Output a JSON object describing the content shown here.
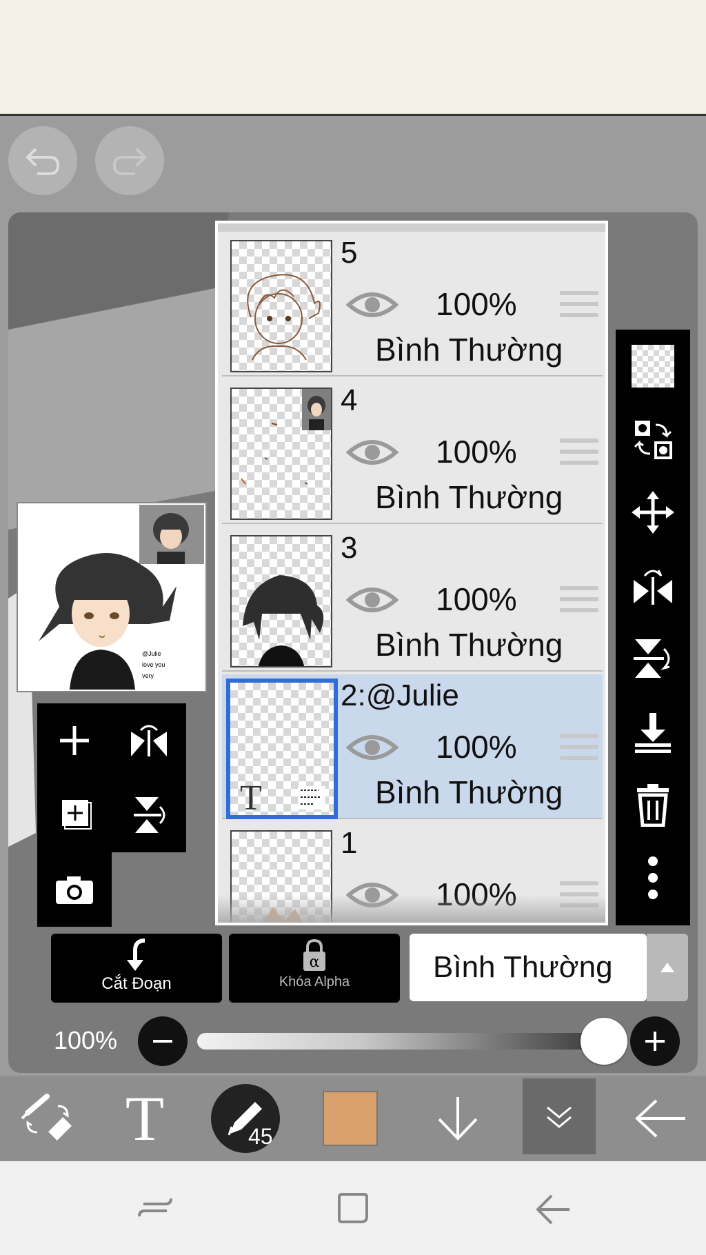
{
  "app": {
    "undo_icon": "undo-icon",
    "redo_icon": "redo-icon"
  },
  "preview": {
    "text": [
      "@Julie",
      "love you",
      "very"
    ]
  },
  "layers": [
    {
      "name": "5",
      "opacity": "100%",
      "blend": "Bình Thường",
      "visible": true,
      "selected": false
    },
    {
      "name": "4",
      "opacity": "100%",
      "blend": "Bình Thường",
      "visible": true,
      "selected": false
    },
    {
      "name": "3",
      "opacity": "100%",
      "blend": "Bình Thường",
      "visible": true,
      "selected": false
    },
    {
      "name": "2:@Julie",
      "opacity": "100%",
      "blend": "Bình Thường",
      "visible": true,
      "selected": true
    },
    {
      "name": "1",
      "opacity": "100%",
      "blend": "",
      "visible": true,
      "selected": false
    }
  ],
  "bottom_actions": {
    "clip_label": "Cắt Đoạn",
    "alpha_lock_label": "Khóa Alpha",
    "blend_mode": "Bình Thường"
  },
  "opacity_slider": {
    "label": "100%",
    "value": 1.0
  },
  "toolbar": {
    "brush_size": "45",
    "color": "#d9a06e"
  },
  "colors": {
    "selection": "#2f6ed8",
    "selected_row": "#cad8ec"
  }
}
